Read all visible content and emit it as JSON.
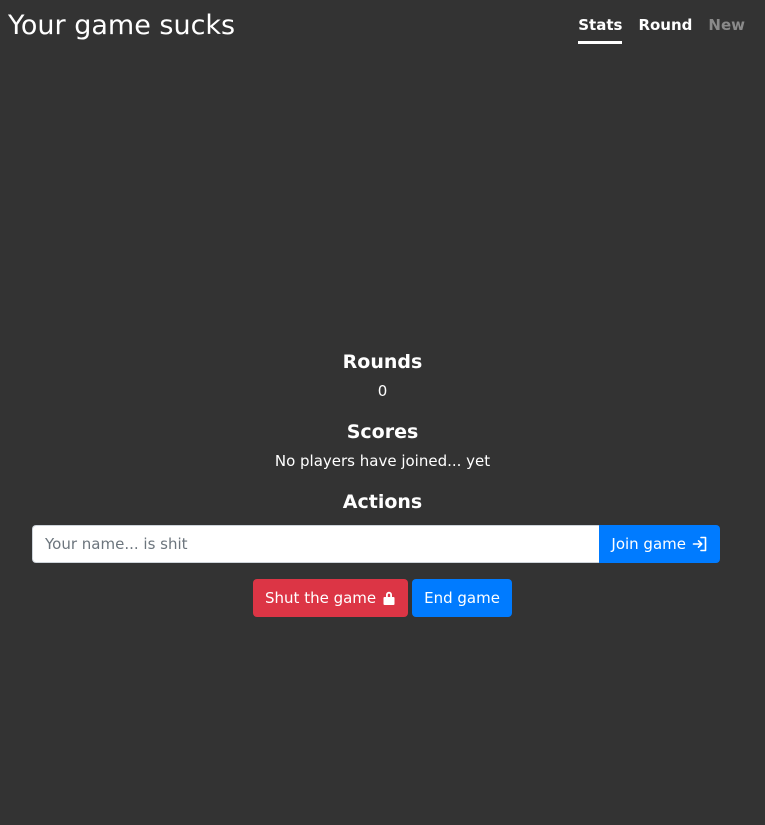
{
  "header": {
    "title": "Your game sucks",
    "tabs": [
      {
        "label": "Stats",
        "state": "active"
      },
      {
        "label": "Round",
        "state": "normal"
      },
      {
        "label": "New",
        "state": "disabled"
      }
    ]
  },
  "main": {
    "rounds": {
      "heading": "Rounds",
      "value": "0"
    },
    "scores": {
      "heading": "Scores",
      "text": "No players have joined... yet"
    },
    "actions": {
      "heading": "Actions",
      "name_input": {
        "placeholder": "Your name... is shit",
        "value": ""
      },
      "join_label": "Join game",
      "join_icon": "sign-in-icon",
      "shut_label": "Shut the game",
      "shut_icon": "lock-icon",
      "end_label": "End game"
    }
  },
  "colors": {
    "background": "#333333",
    "primary": "#007bff",
    "danger": "#dc3545",
    "disabled_text": "#8a8a8a"
  }
}
